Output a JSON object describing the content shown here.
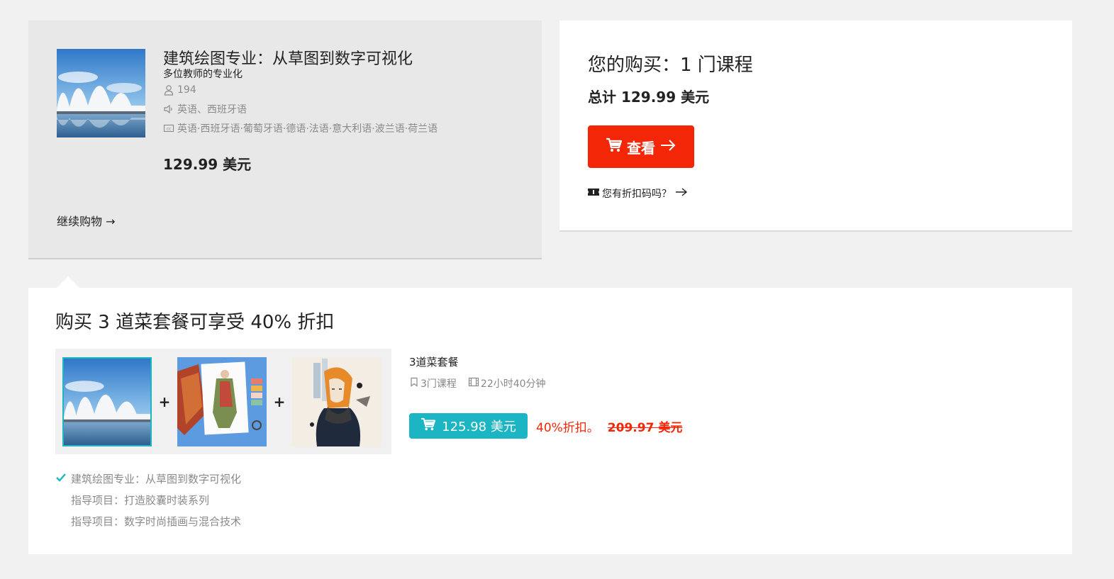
{
  "cart_item": {
    "title": "建筑绘图专业：从草图到数字可视化",
    "subtitle": "多位教师的专业化",
    "students": "194",
    "audio_languages": "英语、西班牙语",
    "subtitle_languages": "英语·西班牙语·葡萄牙语·德语·法语·意大利语·波兰语·荷兰语",
    "price": "129.99 美元",
    "continue_label": "继续购物 →",
    "icons": [
      "user-icon",
      "speaker-icon",
      "cc-icon"
    ]
  },
  "summary": {
    "title": "您的购买：1 门课程",
    "total": "总计 129.99 美元",
    "checkout_label": "查看",
    "coupon_label": "您有折扣码吗？",
    "accent_color": "#f32708"
  },
  "bundle": {
    "title": "购买 3 道菜套餐可享受 40% 折扣",
    "name": "3道菜套餐",
    "courses_count": "3门课程",
    "duration": "22小时40分钟",
    "buy_price": "125.98 美元",
    "discount_text": "40%折扣。",
    "old_price_num": "209.97",
    "old_price_unit": " 美元",
    "plus": "+",
    "accent_color": "#1cb5c4",
    "courses": [
      {
        "label": "建筑绘图专业：从草图到数字可视化",
        "checked": true
      },
      {
        "label": "指导项目：打造胶囊时装系列",
        "checked": false
      },
      {
        "label": "指导项目：数字时尚插画与混合技术",
        "checked": false
      }
    ]
  }
}
